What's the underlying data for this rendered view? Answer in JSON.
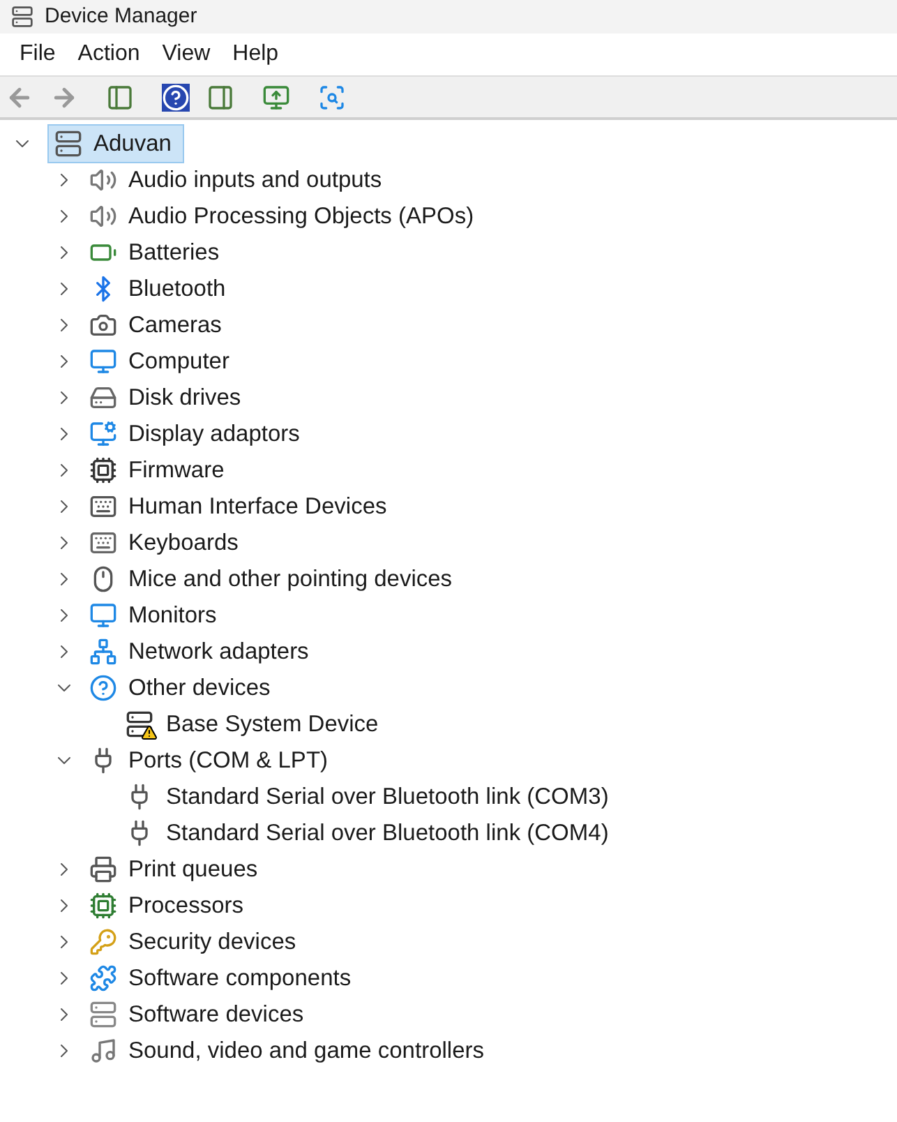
{
  "window": {
    "title": "Device Manager"
  },
  "menu": [
    "File",
    "Action",
    "View",
    "Help"
  ],
  "tree": {
    "label": "Aduvan",
    "expanded": true,
    "selected": true,
    "children": [
      {
        "label": "Audio inputs and outputs",
        "expanded": false
      },
      {
        "label": "Audio Processing Objects (APOs)",
        "expanded": false
      },
      {
        "label": "Batteries",
        "expanded": false
      },
      {
        "label": "Bluetooth",
        "expanded": false
      },
      {
        "label": "Cameras",
        "expanded": false
      },
      {
        "label": "Computer",
        "expanded": false
      },
      {
        "label": "Disk drives",
        "expanded": false
      },
      {
        "label": "Display adaptors",
        "expanded": false
      },
      {
        "label": "Firmware",
        "expanded": false
      },
      {
        "label": "Human Interface Devices",
        "expanded": false
      },
      {
        "label": "Keyboards",
        "expanded": false
      },
      {
        "label": "Mice and other pointing devices",
        "expanded": false
      },
      {
        "label": "Monitors",
        "expanded": false
      },
      {
        "label": "Network adapters",
        "expanded": false
      },
      {
        "label": "Other devices",
        "expanded": true,
        "children": [
          {
            "label": "Base System Device",
            "warning": true
          }
        ]
      },
      {
        "label": "Ports (COM & LPT)",
        "expanded": true,
        "children": [
          {
            "label": "Standard Serial over Bluetooth link (COM3)",
            "warning": false
          },
          {
            "label": "Standard Serial over Bluetooth link (COM4)",
            "warning": false
          }
        ]
      },
      {
        "label": "Print queues",
        "expanded": false
      },
      {
        "label": "Processors",
        "expanded": false
      },
      {
        "label": "Security devices",
        "expanded": false
      },
      {
        "label": "Software components",
        "expanded": false
      },
      {
        "label": "Software devices",
        "expanded": false
      },
      {
        "label": "Sound, video and game controllers",
        "expanded": false
      }
    ]
  }
}
